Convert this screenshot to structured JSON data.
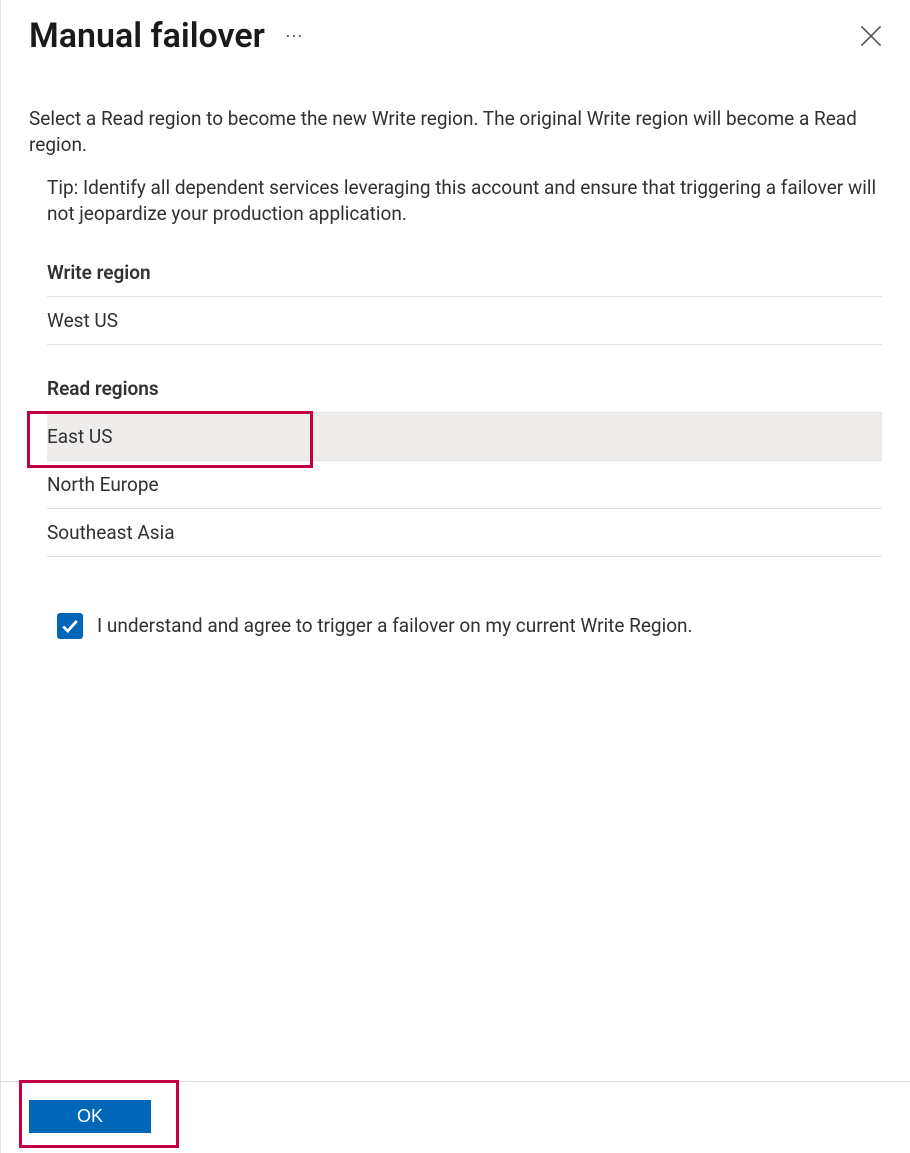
{
  "header": {
    "title": "Manual failover"
  },
  "instruction": "Select a Read region to become the new Write region. The original Write region will become a Read region.",
  "tip": "Tip: Identify all dependent services leveraging this account and ensure that triggering a failover will not jeopardize your production application.",
  "writeRegion": {
    "label": "Write region",
    "value": "West US"
  },
  "readRegions": {
    "label": "Read regions",
    "items": [
      {
        "name": "East US",
        "selected": true
      },
      {
        "name": "North Europe",
        "selected": false
      },
      {
        "name": "Southeast Asia",
        "selected": false
      }
    ]
  },
  "agreement": {
    "checked": true,
    "label": "I understand and agree to trigger a failover on my current Write Region."
  },
  "footer": {
    "okLabel": "OK"
  }
}
